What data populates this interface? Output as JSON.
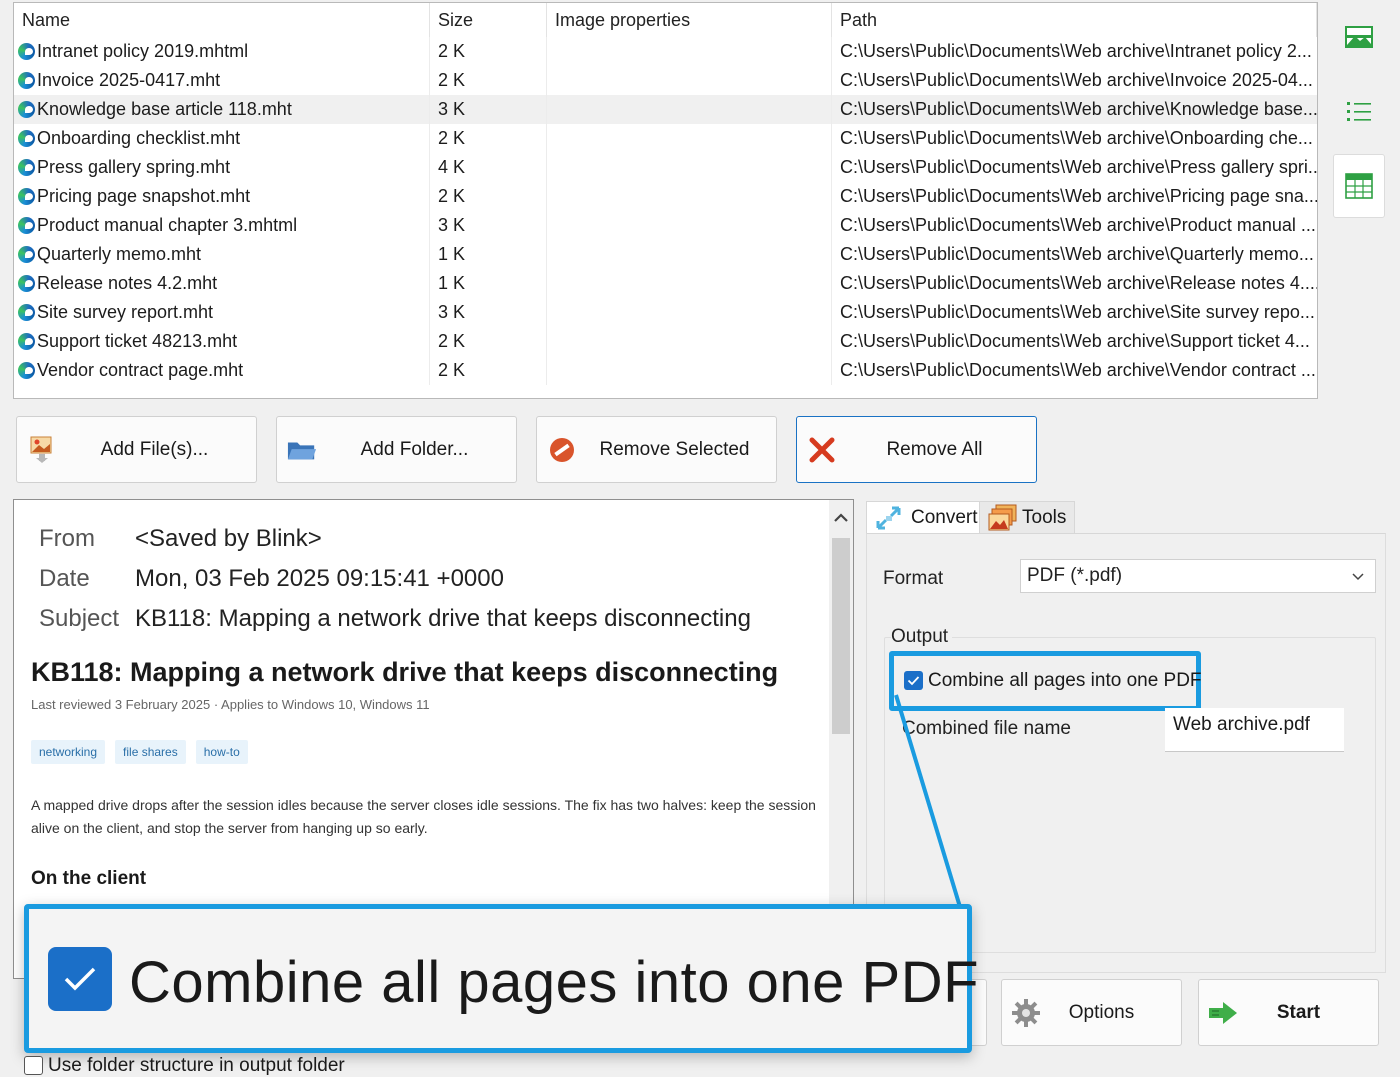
{
  "file_list": {
    "columns": [
      "Name",
      "Size",
      "Image properties",
      "Path"
    ],
    "rows": [
      {
        "name": "Intranet policy 2019.mhtml",
        "size": "2 K",
        "image_properties": "",
        "path": "C:\\Users\\Public\\Documents\\Web archive\\Intranet policy 2..."
      },
      {
        "name": "Invoice 2025-0417.mht",
        "size": "2 K",
        "image_properties": "",
        "path": "C:\\Users\\Public\\Documents\\Web archive\\Invoice 2025-04..."
      },
      {
        "name": "Knowledge base article 118.mht",
        "size": "3 K",
        "image_properties": "",
        "path": "C:\\Users\\Public\\Documents\\Web archive\\Knowledge base..."
      },
      {
        "name": "Onboarding checklist.mht",
        "size": "2 K",
        "image_properties": "",
        "path": "C:\\Users\\Public\\Documents\\Web archive\\Onboarding che..."
      },
      {
        "name": "Press gallery spring.mht",
        "size": "4 K",
        "image_properties": "",
        "path": "C:\\Users\\Public\\Documents\\Web archive\\Press gallery spri..."
      },
      {
        "name": "Pricing page snapshot.mht",
        "size": "2 K",
        "image_properties": "",
        "path": "C:\\Users\\Public\\Documents\\Web archive\\Pricing page sna..."
      },
      {
        "name": "Product manual chapter 3.mhtml",
        "size": "3 K",
        "image_properties": "",
        "path": "C:\\Users\\Public\\Documents\\Web archive\\Product manual ..."
      },
      {
        "name": "Quarterly memo.mht",
        "size": "1 K",
        "image_properties": "",
        "path": "C:\\Users\\Public\\Documents\\Web archive\\Quarterly memo..."
      },
      {
        "name": "Release notes 4.2.mht",
        "size": "1 K",
        "image_properties": "",
        "path": "C:\\Users\\Public\\Documents\\Web archive\\Release notes 4...."
      },
      {
        "name": "Site survey report.mht",
        "size": "3 K",
        "image_properties": "",
        "path": "C:\\Users\\Public\\Documents\\Web archive\\Site survey repo..."
      },
      {
        "name": "Support ticket 48213.mht",
        "size": "2 K",
        "image_properties": "",
        "path": "C:\\Users\\Public\\Documents\\Web archive\\Support ticket 4..."
      },
      {
        "name": "Vendor contract page.mht",
        "size": "2 K",
        "image_properties": "",
        "path": "C:\\Users\\Public\\Documents\\Web archive\\Vendor contract ..."
      }
    ],
    "selected_index": 2,
    "row_icon": "edge-browser-icon"
  },
  "right_toolbar": {
    "icons": [
      "thumbnail-view-icon",
      "list-view-icon",
      "table-view-icon"
    ],
    "active": "table-view-icon"
  },
  "actions": {
    "add_files": "Add File(s)...",
    "add_folder": "Add Folder...",
    "remove_selected": "Remove Selected",
    "remove_all": "Remove All"
  },
  "preview": {
    "from_label": "From",
    "from_value": "<Saved by Blink>",
    "date_label": "Date",
    "date_value": "Mon, 03 Feb 2025 09:15:41 +0000",
    "subject_label": "Subject",
    "subject_value": "KB118: Mapping a network drive that keeps disconnecting",
    "article_title": "KB118: Mapping a network drive that keeps disconnecting",
    "article_meta": "Last reviewed 3 February 2025 · Applies to Windows 10, Windows 11",
    "tags": [
      "networking",
      "file shares",
      "how-to"
    ],
    "paragraph": "A mapped drive drops after the session idles because the server closes idle sessions. The fix has two halves: keep the session alive on the client, and stop the server from hanging up so early.",
    "section_heading": "On the client"
  },
  "tabs": {
    "convert": "Convert",
    "tools": "Tools",
    "active": "convert"
  },
  "convert": {
    "format_label": "Format",
    "format_value": "PDF (*.pdf)",
    "output_group": "Output",
    "combine_label": "Combine all pages into one PDF",
    "combine_checked": true,
    "combined_name_label": "Combined file name",
    "combined_name_value": "Web archive.pdf",
    "folder_structure_label": "Use folder structure in output folder",
    "folder_structure_checked": false
  },
  "zoom_callout": {
    "label": "Combine all pages into one PDF",
    "checked": true
  },
  "bottom_buttons": {
    "options": "Options",
    "start": "Start"
  },
  "colors": {
    "accent": "#1a9be0",
    "checkbox": "#1b6fc8",
    "focus_border": "#1a72c4"
  }
}
